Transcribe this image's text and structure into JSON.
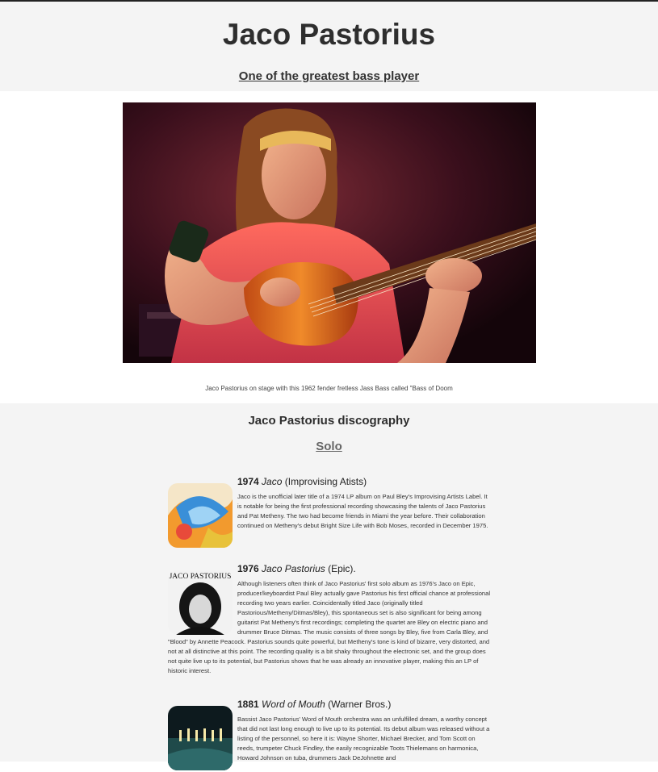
{
  "header": {
    "title": "Jaco Pastorius",
    "subtitle": "One of the greatest bass player"
  },
  "photo": {
    "caption": "Jaco Pastorius on stage with this 1962 fender fretless Jass Bass called \"Bass of Doom"
  },
  "discography": {
    "heading": "Jaco Pastorius discography",
    "subheading": "Solo",
    "albums": [
      {
        "year": "1974",
        "name": "Jaco",
        "label": "(Improvising Atists)",
        "description": "Jaco is the unofficial later title of a 1974 LP album on Paul Bley's Improvising Artists Label. It is notable for being the first professional recording showcasing the talents of Jaco Pastorius and Pat Metheny. The two had become friends in Miami the year before. Their collaboration continued on Metheny's debut Bright Size Life with Bob Moses, recorded in December 1975."
      },
      {
        "year": "1976",
        "name": "Jaco Pastorius",
        "label": "(Epic).",
        "cover_text": "JACO PASTORIUS",
        "description": "Although listeners often think of Jaco Pastorius' first solo album as 1976's Jaco on Epic, producer/keyboardist Paul Bley actually gave Pastorius his first official chance at professional recording two years earlier. Coincidentally titled Jaco (originally titled Pastorious/Metheny/Ditmas/Bley), this spontaneous set is also significant for being among guitarist Pat Metheny's first recordings; completing the quartet are Bley on electric piano and drummer Bruce Ditmas. The music consists of three songs by Bley, five from Carla Bley, and \"Blood\" by Annette Peacock. Pastorius sounds quite powerful, but Metheny's tone is kind of bizarre, very distorted, and not at all distinctive at this point. The recording quality is a bit shaky throughout the electronic set, and the group does not quite live up to its potential, but Pastorius shows that he was already an innovative player, making this an LP of historic interest."
      },
      {
        "year": "1881",
        "name": "Word of Mouth",
        "label": "(Warner Bros.)",
        "description": "Bassist Jaco Pastorius' Word of Mouth orchestra was an unfulfilled dream, a worthy concept that did not last long enough to live up to its potential. Its debut album was released without a listing of the personnel, so here it is: Wayne Shorter, Michael Brecker, and Tom Scott on reeds, trumpeter Chuck Findley, the easily recognizable Toots Thielemans on harmonica, Howard Johnson on tuba, drummers Jack DeJohnette and"
      }
    ]
  }
}
